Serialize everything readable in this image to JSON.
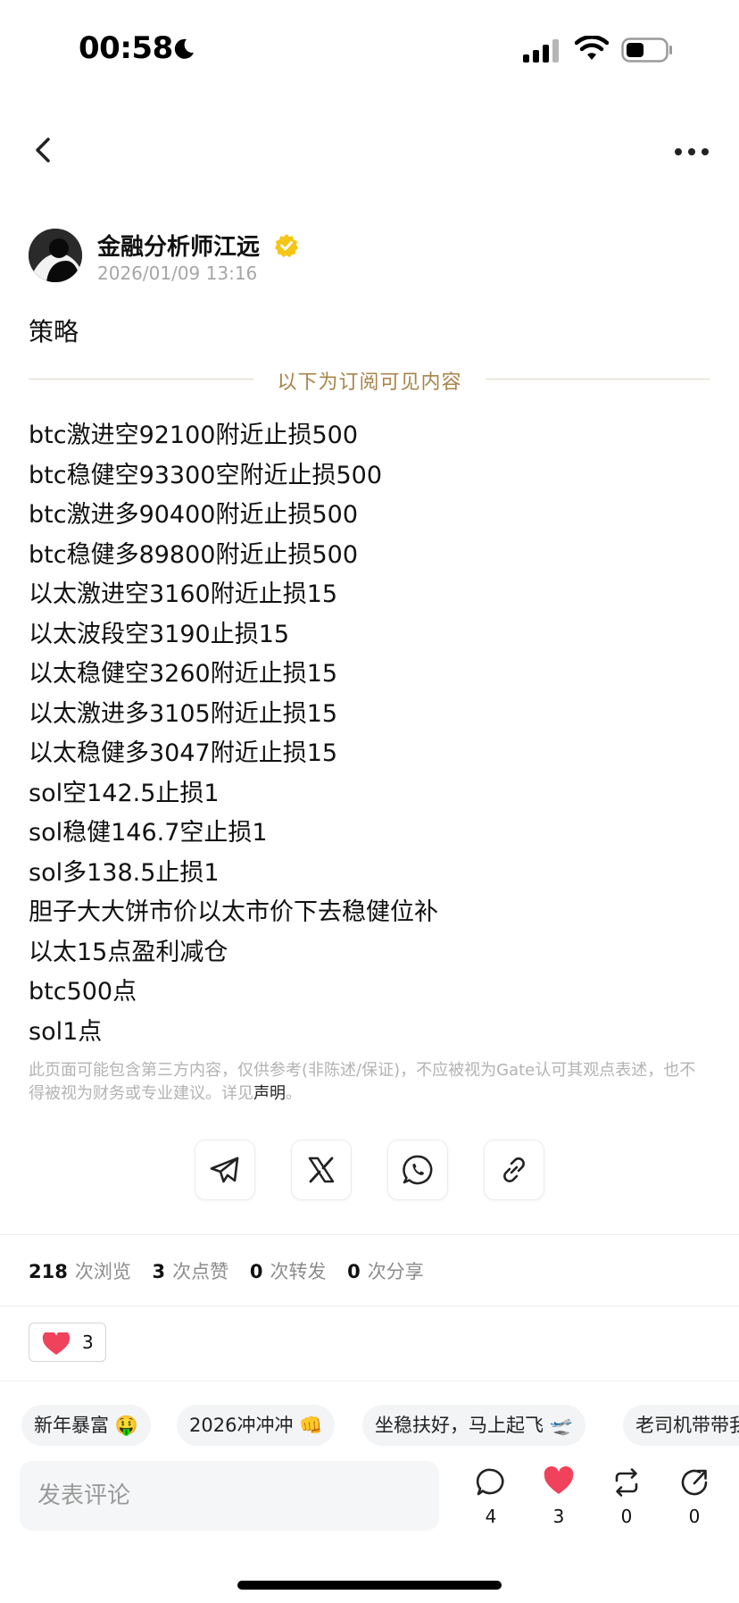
{
  "status_bar": {
    "time": "00:58",
    "icons": [
      "moon-icon",
      "signal-icon",
      "wifi-icon",
      "battery-icon"
    ]
  },
  "nav": {
    "back_icon": "chevron-left-icon",
    "more_icon": "more-horizontal-icon"
  },
  "author": {
    "name": "金融分析师江远",
    "timestamp": "2026/01/09 13:16",
    "verified_icon": "verified-badge-icon",
    "badge_color": "#F5C518"
  },
  "post": {
    "title": "策略",
    "subscriber_divider": "以下为订阅可见内容",
    "lines": [
      "btc激进空92100附近止损500",
      "btc稳健空93300空附近止损500",
      "btc激进多90400附近止损500",
      "btc稳健多89800附近止损500",
      "以太激进空3160附近止损15",
      "以太波段空3190止损15",
      "以太稳健空3260附近止损15",
      "以太激进多3105附近止损15",
      "以太稳健多3047附近止损15",
      "sol空142.5止损1",
      "sol稳健146.7空止损1",
      "sol多138.5止损1",
      "胆子大大饼市价以太市价下去稳健位补",
      "以太15点盈利减仓",
      "btc500点",
      "sol1点"
    ]
  },
  "disclaimer": {
    "text": "此页面可能包含第三方内容，仅供参考(非陈述/保证)，不应被视为Gate认可其观点表述，也不得被视为财务或专业建议。详见",
    "link": "声明",
    "end": "。"
  },
  "share": {
    "buttons": [
      "telegram-icon",
      "x-icon",
      "whatsapp-icon",
      "link-icon"
    ]
  },
  "stats": {
    "views": "218",
    "views_label": "次浏览",
    "likes": "3",
    "likes_label": "次点赞",
    "reposts": "0",
    "reposts_label": "次转发",
    "shares": "0",
    "shares_label": "次分享"
  },
  "reaction": {
    "icon": "heart-icon",
    "count": "3",
    "color": "#F0425B"
  },
  "quick_replies": [
    "新年暴富 🤑",
    "2026冲冲冲 👊",
    "坐稳扶好，马上起飞 🛫",
    "老司机带带我"
  ],
  "bottom": {
    "comment_placeholder": "发表评论",
    "comment_count": "4",
    "like_count": "3",
    "repost_count": "0",
    "share_count": "0"
  }
}
